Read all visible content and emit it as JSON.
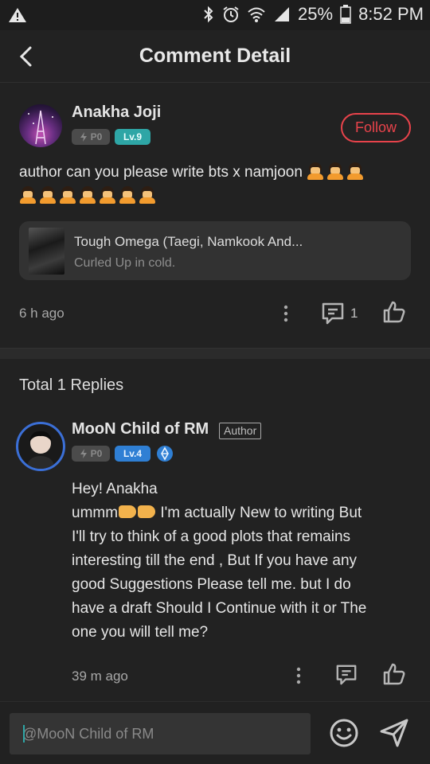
{
  "status_bar": {
    "battery": "25%",
    "time": "8:52 PM"
  },
  "header": {
    "title": "Comment Detail"
  },
  "comment": {
    "author": "Anakha Joji",
    "badge_power": "P0",
    "badge_level": "Lv.9",
    "follow_label": "Follow",
    "text": "author can you please write bts x namjoon",
    "book": {
      "title": "Tough Omega (Taegi, Namkook And...",
      "subtitle": "Curled Up in cold."
    },
    "time": "6 h ago",
    "reply_count": "1"
  },
  "replies_header": "Total 1 Replies",
  "reply": {
    "author": "MooN Child of RM",
    "author_tag": "Author",
    "badge_power": "P0",
    "badge_level": "Lv.4",
    "line1": "Hey!  Anakha",
    "line2_start": "ummm",
    "line2_end": " I'm actually New to writing But",
    "line3": "I'll try to think of a good plots that remains",
    "line4": "interesting till the end , But If you have any",
    "line5": "good Suggestions Please tell me. but I do",
    "line6": "have a draft Should I Continue with it or The",
    "line7": "one you will tell me?",
    "time": "39 m ago"
  },
  "composer": {
    "placeholder": "@MooN Child of RM"
  },
  "colors": {
    "accent_red": "#e8434b",
    "accent_teal": "#2ea6a6",
    "accent_blue": "#2f7fd4",
    "background": "#222222"
  }
}
